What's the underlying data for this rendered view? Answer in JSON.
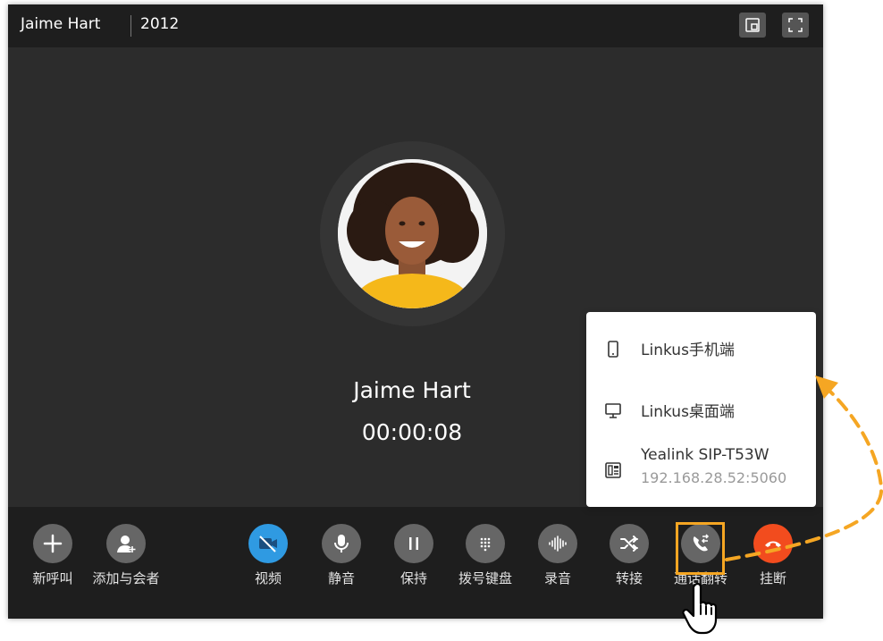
{
  "titlebar": {
    "caller_name": "Jaime Hart",
    "extension": "2012",
    "icons": [
      "picture-in-picture-icon",
      "fullscreen-icon"
    ]
  },
  "call": {
    "caller_name": "Jaime Hart",
    "duration": "00:00:08"
  },
  "controls": [
    {
      "id": "new-call",
      "label": "新呼叫",
      "icon": "plus-icon"
    },
    {
      "id": "add-participant",
      "label": "添加与会者",
      "icon": "add-user-icon"
    },
    {
      "id": "video",
      "label": "视频",
      "icon": "video-off-icon"
    },
    {
      "id": "mute",
      "label": "静音",
      "icon": "microphone-icon"
    },
    {
      "id": "hold",
      "label": "保持",
      "icon": "pause-icon"
    },
    {
      "id": "dialpad",
      "label": "拨号键盘",
      "icon": "dialpad-icon"
    },
    {
      "id": "record",
      "label": "录音",
      "icon": "waveform-icon"
    },
    {
      "id": "transfer",
      "label": "转接",
      "icon": "shuffle-icon"
    },
    {
      "id": "call-flip",
      "label": "通话翻转",
      "icon": "phone-flip-icon"
    },
    {
      "id": "hangup",
      "label": "挂断",
      "icon": "hangup-icon"
    }
  ],
  "flip_menu": {
    "items": [
      {
        "label": "Linkus手机端",
        "icon": "mobile-icon"
      },
      {
        "label": "Linkus桌面端",
        "icon": "desktop-icon"
      },
      {
        "label": "Yealink SIP-T53W",
        "sublabel": "192.168.28.52:5060",
        "icon": "desk-phone-icon"
      }
    ]
  },
  "colors": {
    "window_bg": "#2c2c2c",
    "bar_bg": "#1e1e1e",
    "control_bg": "#666666",
    "video_active": "#2f9ae2",
    "hangup": "#f24c1e",
    "highlight": "#f5a623"
  }
}
